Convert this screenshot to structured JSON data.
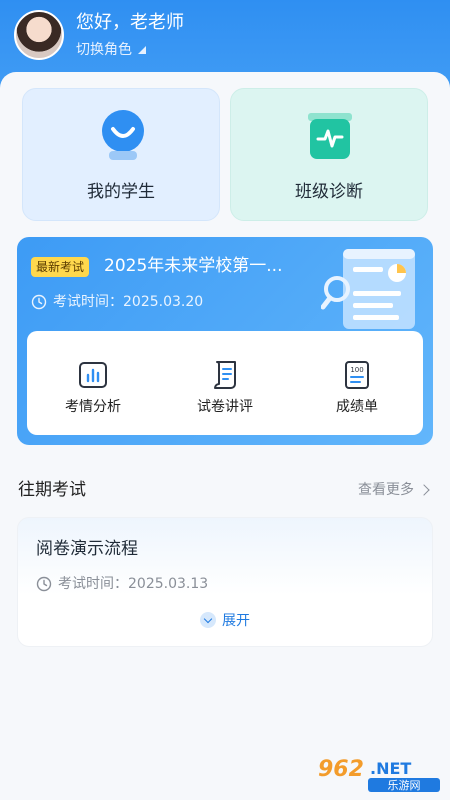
{
  "header": {
    "greeting": "您好，老老师",
    "role_switch": "切换角色"
  },
  "cards": {
    "students": "我的学生",
    "class_diagnosis": "班级诊断"
  },
  "latest_exam": {
    "tag": "最新考试",
    "title": "2025年未来学校第一...",
    "time": "考试时间：2025.03.20",
    "tools": [
      {
        "label": "考情分析",
        "icon": "bar-chart-icon"
      },
      {
        "label": "试卷讲评",
        "icon": "scroll-doc-icon"
      },
      {
        "label": "成绩单",
        "icon": "score-sheet-icon"
      }
    ]
  },
  "past_exams": {
    "section_title": "往期考试",
    "more": "查看更多",
    "items": [
      {
        "title": "阅卷演示流程",
        "time": "考试时间：2025.03.13",
        "expand": "展开"
      }
    ]
  },
  "watermark": {
    "brand": "962.NET",
    "sub": "乐游网"
  },
  "colors": {
    "header_blue": "#2f8ff2",
    "accent_teal": "#21c4a2",
    "tag_yellow": "#ffd84d"
  }
}
